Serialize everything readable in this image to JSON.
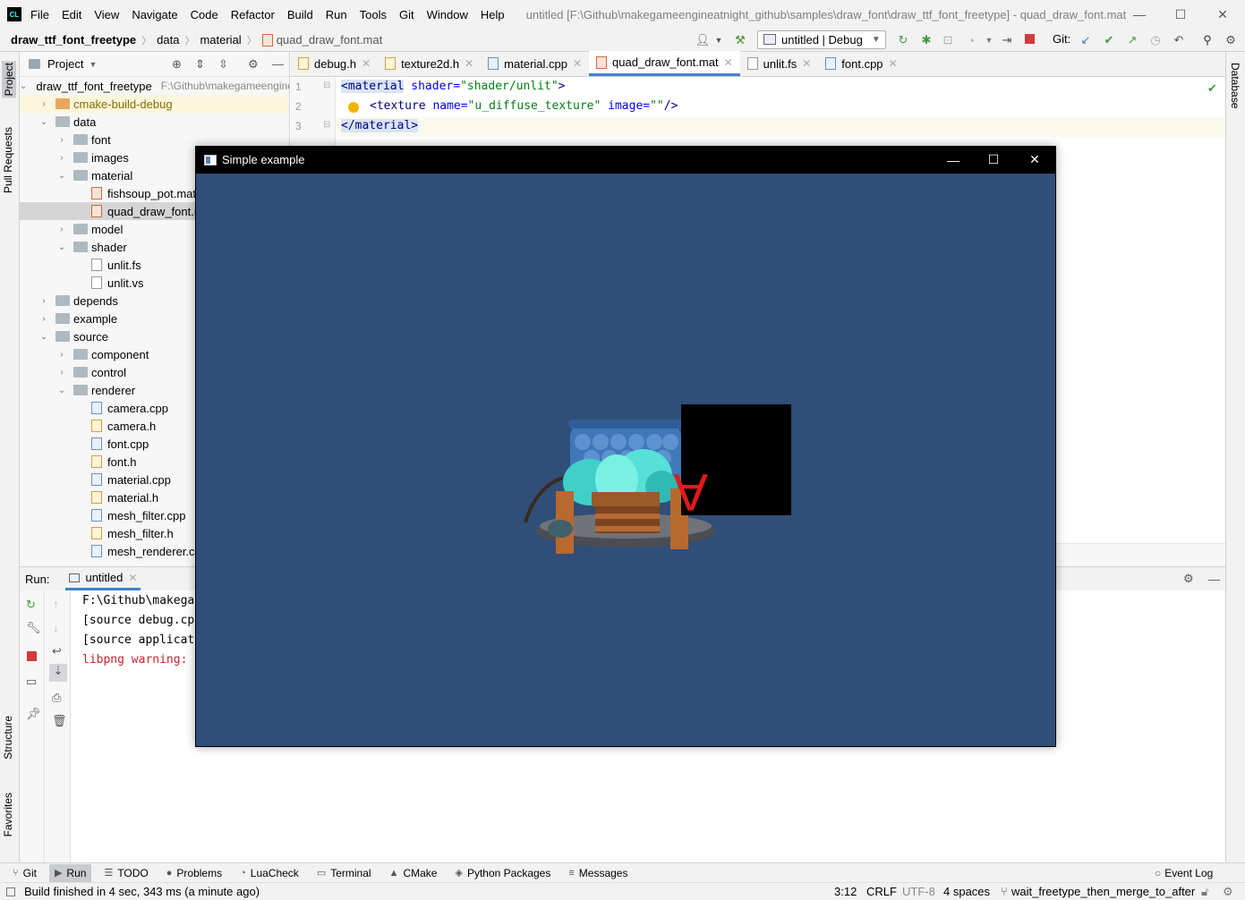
{
  "window": {
    "title": "untitled [F:\\Github\\makegameengineatnight_github\\samples\\draw_font\\draw_ttf_font_freetype] - quad_draw_font.mat",
    "logo_text": "CL"
  },
  "menu": [
    "File",
    "Edit",
    "View",
    "Navigate",
    "Code",
    "Refactor",
    "Build",
    "Run",
    "Tools",
    "Git",
    "Window",
    "Help"
  ],
  "breadcrumb": [
    "draw_ttf_font_freetype",
    "data",
    "material",
    "quad_draw_font.mat"
  ],
  "toolbar": {
    "run_config": "untitled | Debug",
    "git_label": "Git:"
  },
  "left_strip": {
    "project": "Project",
    "pull_requests": "Pull Requests",
    "structure": "Structure",
    "favorites": "Favorites"
  },
  "right_strip": {
    "database": "Database"
  },
  "project_panel": {
    "title": "Project",
    "root_name": "draw_ttf_font_freetype",
    "root_path": "F:\\Github\\makegameengineatnight_github",
    "tree": [
      {
        "label": "cmake-build-debug",
        "kind": "folder-orange",
        "depth": 1,
        "caret": ">"
      },
      {
        "label": "data",
        "kind": "folder",
        "depth": 1,
        "caret": "v"
      },
      {
        "label": "font",
        "kind": "folder",
        "depth": 2,
        "caret": ">"
      },
      {
        "label": "images",
        "kind": "folder",
        "depth": 2,
        "caret": ">"
      },
      {
        "label": "material",
        "kind": "folder",
        "depth": 2,
        "caret": "v"
      },
      {
        "label": "fishsoup_pot.mat",
        "kind": "mat",
        "depth": 3,
        "caret": ""
      },
      {
        "label": "quad_draw_font.mat",
        "kind": "mat",
        "depth": 3,
        "caret": "",
        "selected": true
      },
      {
        "label": "model",
        "kind": "folder",
        "depth": 2,
        "caret": ">"
      },
      {
        "label": "shader",
        "kind": "folder",
        "depth": 2,
        "caret": "v"
      },
      {
        "label": "unlit.fs",
        "kind": "txt",
        "depth": 3,
        "caret": ""
      },
      {
        "label": "unlit.vs",
        "kind": "txt",
        "depth": 3,
        "caret": ""
      },
      {
        "label": "depends",
        "kind": "folder",
        "depth": 1,
        "caret": ">"
      },
      {
        "label": "example",
        "kind": "folder",
        "depth": 1,
        "caret": ">"
      },
      {
        "label": "source",
        "kind": "folder",
        "depth": 1,
        "caret": "v"
      },
      {
        "label": "component",
        "kind": "folder",
        "depth": 2,
        "caret": ">"
      },
      {
        "label": "control",
        "kind": "folder",
        "depth": 2,
        "caret": ">"
      },
      {
        "label": "renderer",
        "kind": "folder",
        "depth": 2,
        "caret": "v"
      },
      {
        "label": "camera.cpp",
        "kind": "cpp",
        "depth": 3,
        "caret": ""
      },
      {
        "label": "camera.h",
        "kind": "h",
        "depth": 3,
        "caret": ""
      },
      {
        "label": "font.cpp",
        "kind": "cpp",
        "depth": 3,
        "caret": ""
      },
      {
        "label": "font.h",
        "kind": "h",
        "depth": 3,
        "caret": ""
      },
      {
        "label": "material.cpp",
        "kind": "cpp",
        "depth": 3,
        "caret": ""
      },
      {
        "label": "material.h",
        "kind": "h",
        "depth": 3,
        "caret": ""
      },
      {
        "label": "mesh_filter.cpp",
        "kind": "cpp",
        "depth": 3,
        "caret": ""
      },
      {
        "label": "mesh_filter.h",
        "kind": "h",
        "depth": 3,
        "caret": ""
      },
      {
        "label": "mesh_renderer.cpp",
        "kind": "cpp",
        "depth": 3,
        "caret": ""
      }
    ]
  },
  "editor_tabs": [
    {
      "label": "debug.h",
      "kind": "h",
      "active": false
    },
    {
      "label": "texture2d.h",
      "kind": "h",
      "active": false
    },
    {
      "label": "material.cpp",
      "kind": "cpp",
      "active": false
    },
    {
      "label": "quad_draw_font.mat",
      "kind": "mat",
      "active": true
    },
    {
      "label": "unlit.fs",
      "kind": "txt",
      "active": false
    },
    {
      "label": "font.cpp",
      "kind": "cpp",
      "active": false
    }
  ],
  "code": {
    "line_numbers": [
      "1",
      "2",
      "3"
    ],
    "l1_tag": "<material",
    "l1_attr": "shader",
    "l1_eq": "=",
    "l1_val": "\"shader/unlit\"",
    "l1_end": ">",
    "l2_tag": "<texture",
    "l2_attr1": "name",
    "l2_val1": "\"u_diffuse_texture\"",
    "l2_attr2": "image",
    "l2_val2": "\"\"",
    "l2_end": "/>",
    "l3_tag": "</material>"
  },
  "run_panel": {
    "label": "Run:",
    "tab": "untitled",
    "lines": [
      {
        "text": "F:\\Github\\makega",
        "color": "#000000"
      },
      {
        "text": "[source debug.cp",
        "color": "#000000"
      },
      {
        "text": "[source applicat",
        "color": "#000000"
      },
      {
        "text": "libpng warning: ",
        "color": "#c7222d"
      }
    ]
  },
  "bottom_tools": [
    {
      "label": "Git",
      "icon": "git-icon",
      "glyph": "⑂"
    },
    {
      "label": "Run",
      "icon": "run-icon",
      "glyph": "▶",
      "active": true
    },
    {
      "label": "TODO",
      "icon": "todo-icon",
      "glyph": "☰"
    },
    {
      "label": "Problems",
      "icon": "problems-icon",
      "glyph": "●"
    },
    {
      "label": "LuaCheck",
      "icon": "luacheck-icon",
      "glyph": "◔"
    },
    {
      "label": "Terminal",
      "icon": "terminal-icon",
      "glyph": "▭"
    },
    {
      "label": "CMake",
      "icon": "cmake-icon",
      "glyph": "▲"
    },
    {
      "label": "Python Packages",
      "icon": "python-packages-icon",
      "glyph": "◈"
    },
    {
      "label": "Messages",
      "icon": "messages-icon",
      "glyph": "≡"
    }
  ],
  "event_log": "Event Log",
  "status": {
    "message": "Build finished in 4 sec, 343 ms (a minute ago)",
    "position": "3:12",
    "line_sep": "CRLF",
    "encoding": "UTF-8",
    "indent": "4 spaces",
    "branch": "wait_freetype_then_merge_to_after"
  },
  "sim_window": {
    "title": "Simple example",
    "canvas_color": "#304e78",
    "glyph": "A"
  },
  "colors": {
    "accent": "#4083c9",
    "selection": "#d5d5d5",
    "tag_highlight": "#d9e4f5",
    "keyword": "#000080",
    "attr": "#0000ff",
    "string": "#067d17",
    "glyph_red": "#e01b1b"
  }
}
